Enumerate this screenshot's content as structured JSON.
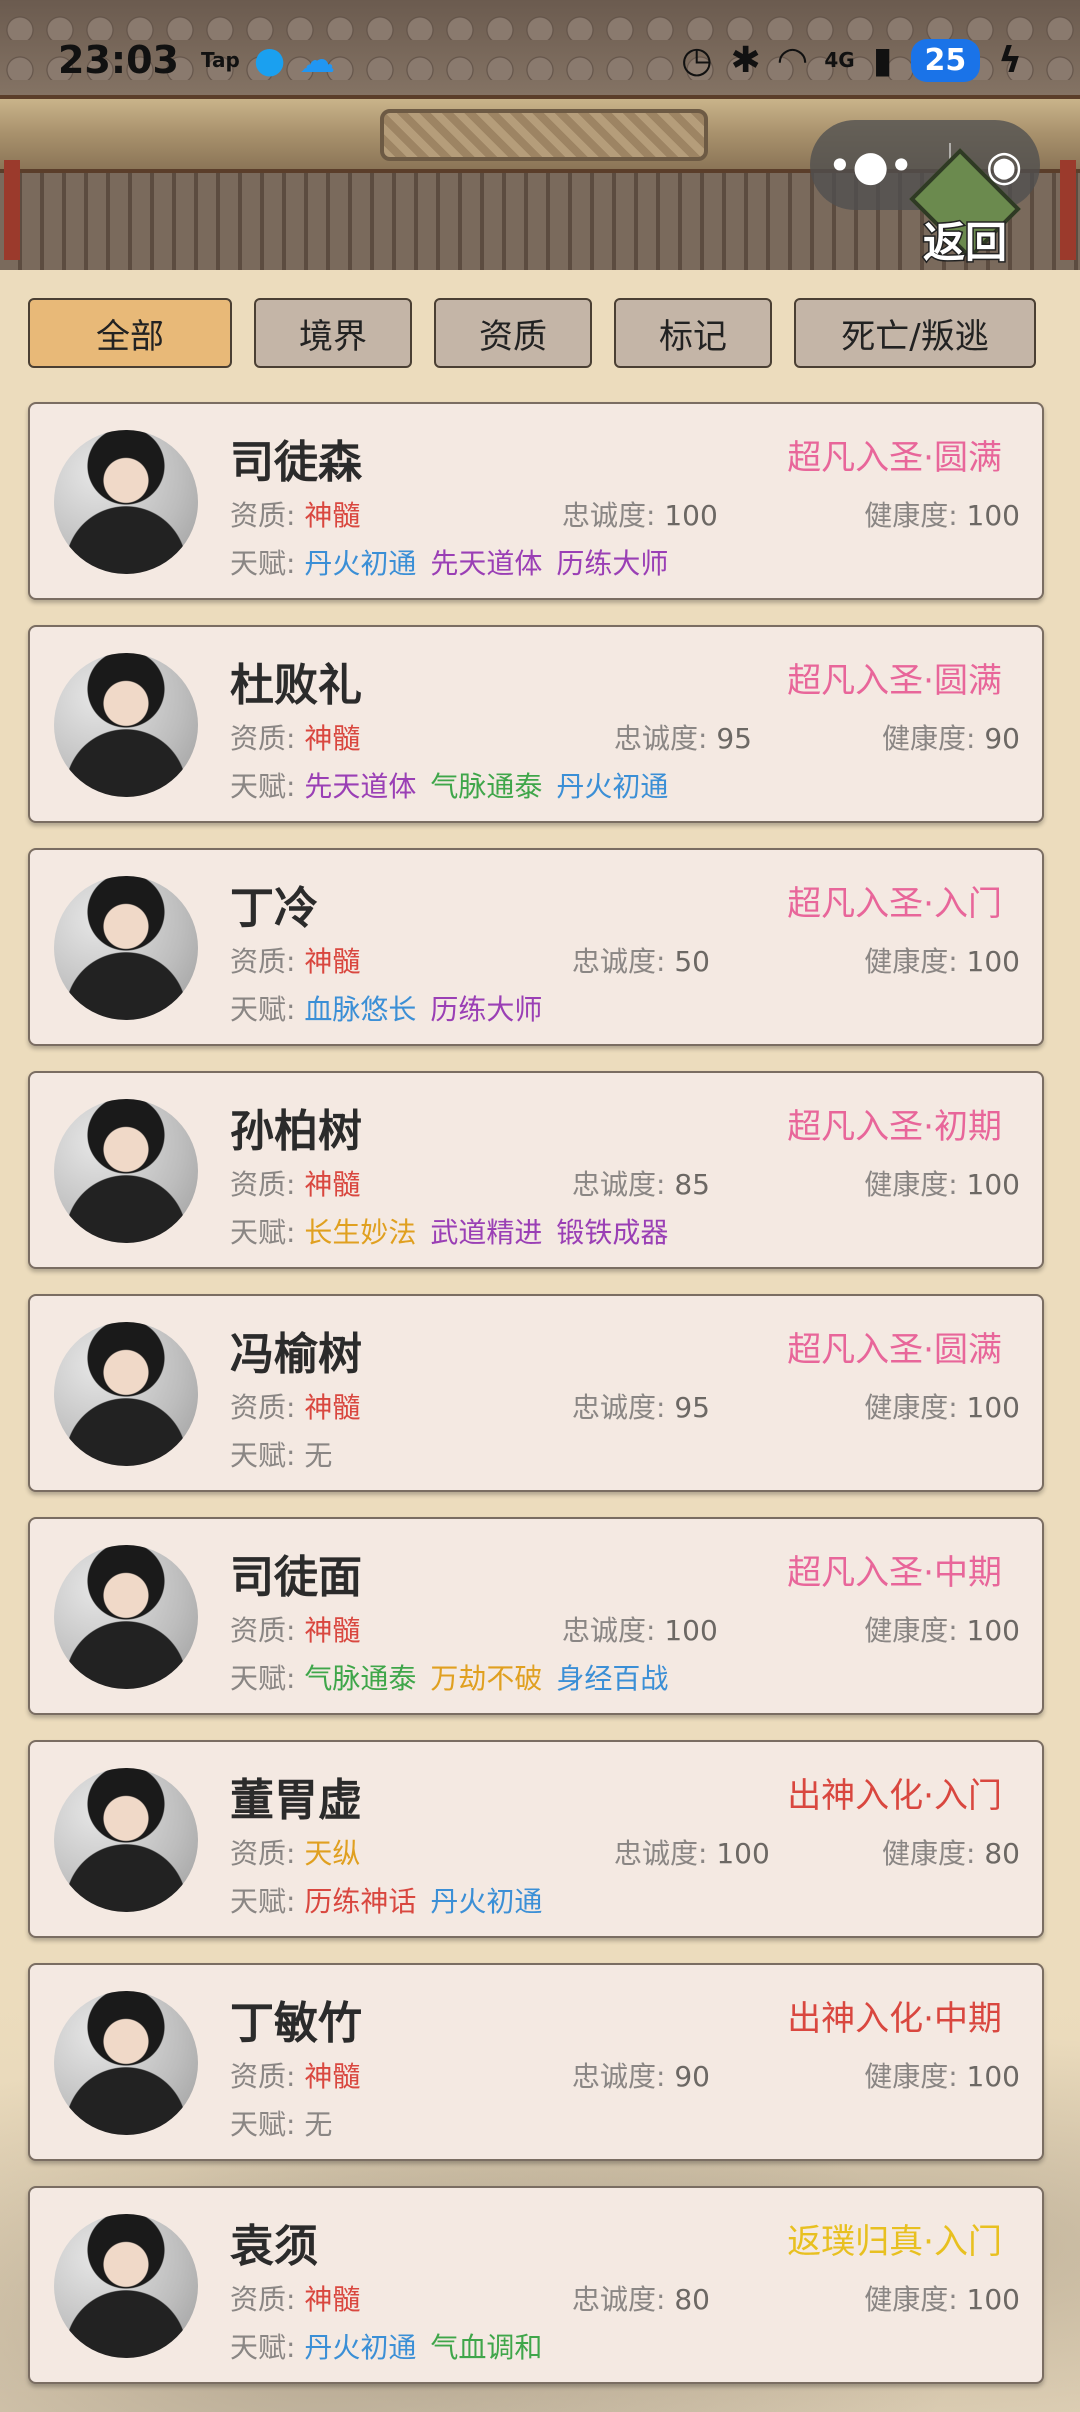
{
  "status_bar": {
    "time": "23:03",
    "tap_label": "Tap",
    "battery": "25",
    "network": "4G"
  },
  "capsule": {
    "more": "•●•",
    "close": "◉"
  },
  "back_button": {
    "label": "返回"
  },
  "tabs": [
    {
      "label": "全部",
      "active": true
    },
    {
      "label": "境界",
      "active": false
    },
    {
      "label": "资质",
      "active": false
    },
    {
      "label": "标记",
      "active": false
    },
    {
      "label": "死亡/叛逃",
      "active": false
    }
  ],
  "labels": {
    "aptitude": "资质:",
    "loyalty": "忠诚度:",
    "health": "健康度:",
    "talent": "天赋:"
  },
  "colors": {
    "realm_pink": "#e8669a",
    "realm_red": "#d9473f",
    "realm_gold": "#e8b320",
    "aptitude_red": "#d9473f",
    "aptitude_gold": "#e0a020",
    "talent_blue": "#3b8fd6",
    "talent_purple": "#9a3fb5",
    "talent_green": "#3fa64a",
    "talent_orange": "#e0a020",
    "talent_red": "#d9473f"
  },
  "disciples": [
    {
      "name": "司徒森",
      "realm": "超凡入圣·圆满",
      "realm_color": "#e8669a",
      "aptitude": "神髓",
      "aptitude_color": "#d9473f",
      "loyalty": "100",
      "health": "100",
      "talents": [
        {
          "text": "丹火初通",
          "color": "#3b8fd6"
        },
        {
          "text": "先天道体",
          "color": "#9a3fb5"
        },
        {
          "text": "历练大师",
          "color": "#9a3fb5"
        }
      ]
    },
    {
      "name": "杜败礼",
      "realm": "超凡入圣·圆满",
      "realm_color": "#e8669a",
      "aptitude": "神髓",
      "aptitude_color": "#d9473f",
      "loyalty": "95",
      "health": "90",
      "talents": [
        {
          "text": "先天道体",
          "color": "#9a3fb5"
        },
        {
          "text": "气脉通泰",
          "color": "#3fa64a"
        },
        {
          "text": "丹火初通",
          "color": "#3b8fd6"
        }
      ]
    },
    {
      "name": "丁冷",
      "realm": "超凡入圣·入门",
      "realm_color": "#e8669a",
      "aptitude": "神髓",
      "aptitude_color": "#d9473f",
      "loyalty": "50",
      "health": "100",
      "talents": [
        {
          "text": "血脉悠长",
          "color": "#3b8fd6"
        },
        {
          "text": "历练大师",
          "color": "#9a3fb5"
        }
      ]
    },
    {
      "name": "孙柏树",
      "realm": "超凡入圣·初期",
      "realm_color": "#e8669a",
      "aptitude": "神髓",
      "aptitude_color": "#d9473f",
      "loyalty": "85",
      "health": "100",
      "talents": [
        {
          "text": "长生妙法",
          "color": "#e0a020"
        },
        {
          "text": "武道精进",
          "color": "#9a3fb5"
        },
        {
          "text": "锻铁成器",
          "color": "#9a3fb5"
        }
      ]
    },
    {
      "name": "冯榆树",
      "realm": "超凡入圣·圆满",
      "realm_color": "#e8669a",
      "aptitude": "神髓",
      "aptitude_color": "#d9473f",
      "loyalty": "95",
      "health": "100",
      "talents": [
        {
          "text": "无",
          "color": "#8a8684"
        }
      ]
    },
    {
      "name": "司徒面",
      "realm": "超凡入圣·中期",
      "realm_color": "#e8669a",
      "aptitude": "神髓",
      "aptitude_color": "#d9473f",
      "loyalty": "100",
      "health": "100",
      "talents": [
        {
          "text": "气脉通泰",
          "color": "#3fa64a"
        },
        {
          "text": "万劫不破",
          "color": "#e0a020"
        },
        {
          "text": "身经百战",
          "color": "#3b8fd6"
        }
      ]
    },
    {
      "name": "董胃虚",
      "realm": "出神入化·入门",
      "realm_color": "#d9473f",
      "aptitude": "天纵",
      "aptitude_color": "#e0a020",
      "loyalty": "100",
      "health": "80",
      "talents": [
        {
          "text": "历练神话",
          "color": "#d9473f"
        },
        {
          "text": "丹火初通",
          "color": "#3b8fd6"
        }
      ]
    },
    {
      "name": "丁敏竹",
      "realm": "出神入化·中期",
      "realm_color": "#d9473f",
      "aptitude": "神髓",
      "aptitude_color": "#d9473f",
      "loyalty": "90",
      "health": "100",
      "talents": [
        {
          "text": "无",
          "color": "#8a8684"
        }
      ]
    },
    {
      "name": "袁须",
      "realm": "返璞归真·入门",
      "realm_color": "#e8c020",
      "aptitude": "神髓",
      "aptitude_color": "#d9473f",
      "loyalty": "80",
      "health": "100",
      "talents": [
        {
          "text": "丹火初通",
          "color": "#3b8fd6"
        },
        {
          "text": "气血调和",
          "color": "#3fa64a"
        }
      ]
    }
  ]
}
